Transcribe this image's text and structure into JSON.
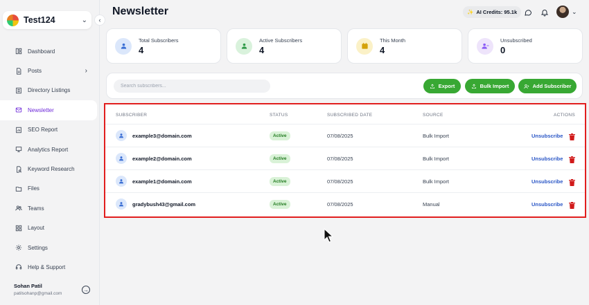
{
  "workspace": {
    "name": "Test124"
  },
  "sidebar": {
    "items": [
      {
        "label": "Dashboard",
        "icon": "dashboard-icon"
      },
      {
        "label": "Posts",
        "icon": "document-icon",
        "has_submenu": true
      },
      {
        "label": "Directory Listings",
        "icon": "list-icon"
      },
      {
        "label": "Newsletter",
        "icon": "mail-icon",
        "active": true
      },
      {
        "label": "SEO Report",
        "icon": "report-icon"
      },
      {
        "label": "Analytics Report",
        "icon": "monitor-icon"
      },
      {
        "label": "Keyword Research",
        "icon": "search-document-icon"
      },
      {
        "label": "Files",
        "icon": "folder-icon"
      },
      {
        "label": "Teams",
        "icon": "users-icon"
      },
      {
        "label": "Layout",
        "icon": "grid-icon"
      },
      {
        "label": "Settings",
        "icon": "gear-icon"
      },
      {
        "label": "Help & Support",
        "icon": "headset-icon"
      }
    ],
    "user": {
      "name": "Sohan Patil",
      "email": "patilsohanp@gmail.com"
    }
  },
  "header": {
    "title": "Newsletter",
    "credits": "AI Credits: 95.1k"
  },
  "stats": [
    {
      "label": "Total Subscribers",
      "value": "4",
      "icon": "user-icon",
      "color": "#dbe7fb",
      "icon_color": "#3b6fd4"
    },
    {
      "label": "Active Subscribers",
      "value": "4",
      "icon": "user-icon",
      "color": "#d9f2dc",
      "icon_color": "#2f9a48"
    },
    {
      "label": "This Month",
      "value": "4",
      "icon": "calendar-icon",
      "color": "#fbf1c7",
      "icon_color": "#d4a20a"
    },
    {
      "label": "Unsubscribed",
      "value": "0",
      "icon": "user-minus-icon",
      "color": "#eee4fb",
      "icon_color": "#8b5cf6"
    }
  ],
  "toolbar": {
    "search_placeholder": "Search subscribers...",
    "export_label": "Export",
    "bulk_import_label": "Bulk Import",
    "add_label": "Add Subscriber"
  },
  "table": {
    "headers": {
      "subscriber": "SUBSCRIBER",
      "status": "STATUS",
      "date": "SUBSCRIBED DATE",
      "source": "SOURCE",
      "actions": "ACTIONS"
    },
    "action_label": "Unsubscribe",
    "rows": [
      {
        "email": "example3@domain.com",
        "status": "Active",
        "date": "07/08/2025",
        "source": "Bulk Import"
      },
      {
        "email": "example2@domain.com",
        "status": "Active",
        "date": "07/08/2025",
        "source": "Bulk Import"
      },
      {
        "email": "example1@domain.com",
        "status": "Active",
        "date": "07/08/2025",
        "source": "Bulk Import"
      },
      {
        "email": "gradybush43@gmail.com",
        "status": "Active",
        "date": "07/08/2025",
        "source": "Manual"
      }
    ]
  },
  "colors": {
    "accent": "#6d28d9",
    "button": "#38a833",
    "highlight": "#e11d1d",
    "link": "#2a56c6"
  }
}
